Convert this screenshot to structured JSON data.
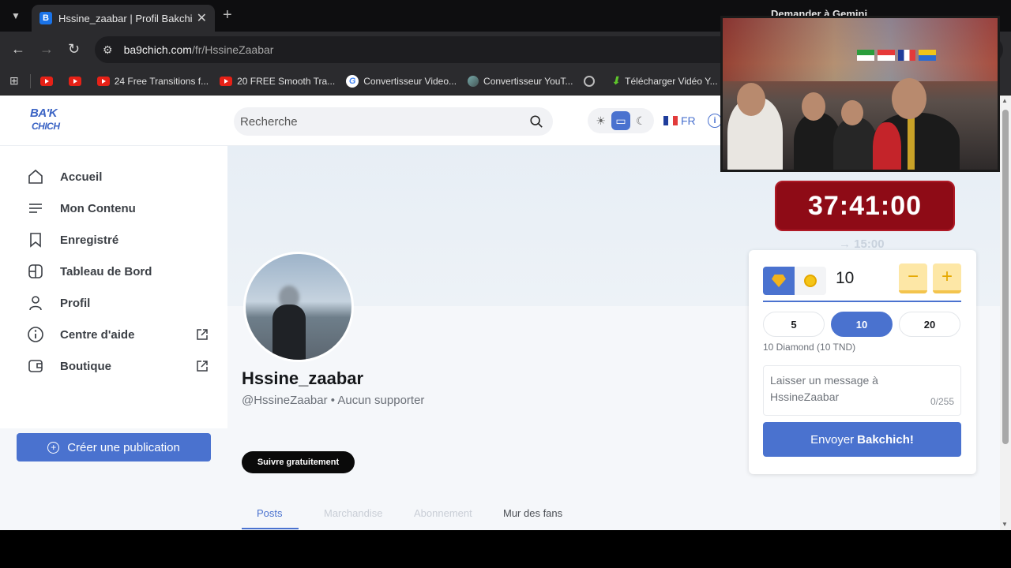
{
  "browser": {
    "tab_title": "Hssine_zaabar | Profil Bakchich",
    "favicon_letter": "B",
    "url_host": "ba9chich.com",
    "url_path": "/fr/HssineZaabar",
    "gemini_label": "Demander à Gemini",
    "bookmarks": [
      {
        "icon": "youtube-icon",
        "label": ""
      },
      {
        "icon": "youtube-icon",
        "label": ""
      },
      {
        "icon": "youtube-icon",
        "label": "24 Free Transitions f..."
      },
      {
        "icon": "youtube-icon",
        "label": "20 FREE Smooth Tra..."
      },
      {
        "icon": "google-icon",
        "label": "Convertisseur Video..."
      },
      {
        "icon": "converter-icon",
        "label": "Convertisseur YouT..."
      },
      {
        "icon": "globe-icon",
        "label": ""
      },
      {
        "icon": "download-icon",
        "label": "Télécharger Vidéo Y..."
      }
    ]
  },
  "header": {
    "logo_top": "BA'K",
    "logo_bottom": "CHICH",
    "search_placeholder": "Recherche",
    "lang": "FR"
  },
  "sidebar": {
    "items": [
      {
        "label": "Accueil",
        "icon": "home-icon"
      },
      {
        "label": "Mon Contenu",
        "icon": "menu-lines-icon"
      },
      {
        "label": "Enregistré",
        "icon": "bookmark-icon"
      },
      {
        "label": "Tableau de Bord",
        "icon": "dashboard-icon"
      },
      {
        "label": "Profil",
        "icon": "user-icon"
      },
      {
        "label": "Centre d'aide",
        "icon": "info-icon"
      },
      {
        "label": "Boutique",
        "icon": "wallet-icon"
      }
    ],
    "create_label": "Créer une publication"
  },
  "profile": {
    "name": "Hssine_zaabar",
    "handle": "@HssineZaabar • Aucun supporter",
    "follow_label": "Suivre gratuitement",
    "tabs": [
      {
        "label": "Posts",
        "state": "active"
      },
      {
        "label": "Marchandise",
        "state": "disabled"
      },
      {
        "label": "Abonnement",
        "state": "disabled"
      },
      {
        "label": "Mur des fans",
        "state": "normal"
      }
    ]
  },
  "overlay": {
    "timer": "37:41:00",
    "timer_sub": "→ 15:00"
  },
  "tip": {
    "amount": "10",
    "minus": "−",
    "plus": "+",
    "presets": [
      {
        "label": "5",
        "active": false
      },
      {
        "label": "10",
        "active": true
      },
      {
        "label": "20",
        "active": false
      }
    ],
    "info": "10 Diamond (10 TND)",
    "message_placeholder": "Laisser un message à HssineZaabar",
    "message_count": "0/255",
    "send_prefix": "Envoyer",
    "send_bold": "Bakchich!"
  },
  "colors": {
    "accent": "#4a72cf",
    "timer_bg": "#8e0b16",
    "step_bg": "#fde7a6"
  }
}
